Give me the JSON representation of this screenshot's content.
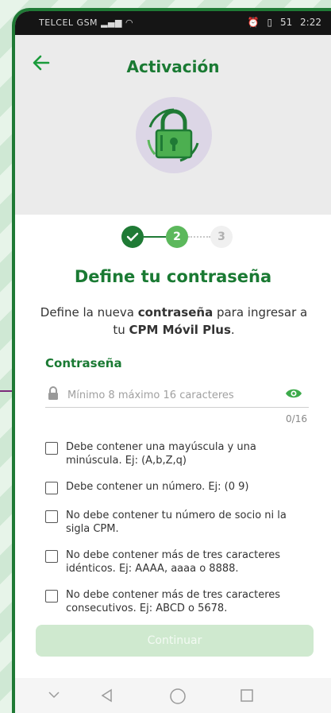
{
  "status_bar": {
    "carrier": "TELCEL GSM",
    "time": "2:22",
    "battery": "51"
  },
  "header": {
    "title": "Activación"
  },
  "steps": [
    "2",
    "3"
  ],
  "heading": "Define tu contraseña",
  "description": {
    "part1": "Define la nueva ",
    "bold1": "contraseña",
    "part2": " para ingresar a tu ",
    "bold2": "CPM Móvil Plus",
    "part3": "."
  },
  "password": {
    "label": "Contraseña",
    "placeholder": "Mínimo 8 máximo 16 caracteres",
    "counter": "0/16"
  },
  "rules": [
    "Debe contener una mayúscula y una minúscula. Ej: (A,b,Z,q)",
    "Debe contener un número. Ej: (0 9)",
    "No debe contener tu número de socio ni la sigla CPM.",
    "No debe contener más de tres caracteres idénticos. Ej: AAAA, aaaa o 8888.",
    "No debe contener más de tres caracteres consecutivos. Ej: ABCD o 5678."
  ],
  "continue_label": "Continuar",
  "colors": {
    "primary": "#1a7a33",
    "accent": "#5cb85c",
    "callout": "#7b2a7a"
  }
}
